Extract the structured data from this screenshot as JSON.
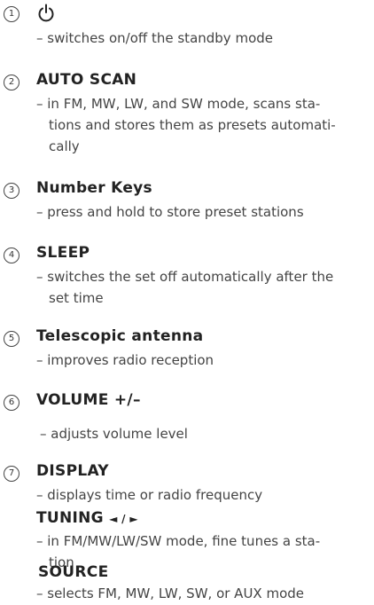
{
  "items": [
    {
      "number": "1",
      "icon": "power-icon",
      "desc_lines": [
        "– switches on/off the standby mode"
      ]
    },
    {
      "number": "2",
      "title": "AUTO SCAN",
      "desc_lines": [
        "– in FM, MW, LW, and SW mode, scans sta-",
        "tions and stores them as presets automati-",
        "cally"
      ]
    },
    {
      "number": "3",
      "title": "Number Keys",
      "desc_lines": [
        "– press and hold to store preset stations"
      ]
    },
    {
      "number": "4",
      "title": "SLEEP",
      "desc_lines": [
        "– switches the set off automatically after the",
        "set time"
      ]
    },
    {
      "number": "5",
      "title": "Telescopic antenna",
      "desc_lines": [
        "– improves radio reception"
      ]
    },
    {
      "number": "6",
      "title": "VOLUME +/–",
      "desc_lines": [
        "– adjusts volume level"
      ]
    },
    {
      "number": "7",
      "title": "DISPLAY",
      "desc_lines": [
        "– displays time or radio frequency"
      ]
    },
    {
      "title": "TUNING",
      "title_suffix": "◄ / ►",
      "desc_lines": [
        "– in FM/MW/LW/SW mode, fine tunes a sta-",
        "tion"
      ]
    },
    {
      "title": "SOURCE",
      "desc_lines": [
        "– selects FM, MW, LW, SW, or AUX mode"
      ]
    }
  ]
}
